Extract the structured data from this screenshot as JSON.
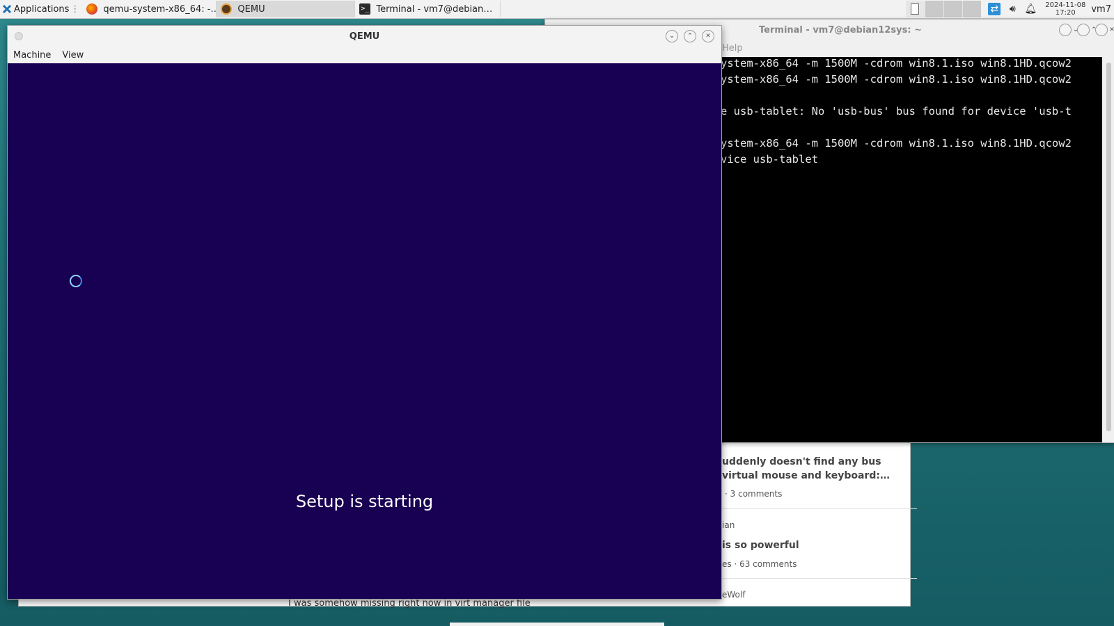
{
  "panel": {
    "applications_label": "Applications",
    "tasks": [
      {
        "label": "qemu-system-x86_64: -…",
        "icon": "firefox-icon"
      },
      {
        "label": "QEMU",
        "icon": "qemu-icon"
      },
      {
        "label": "Terminal - vm7@debian…",
        "icon": "terminal-icon"
      }
    ],
    "clock_date": "2024-11-08",
    "clock_time": "17:20",
    "user": "vm7"
  },
  "browser": {
    "card1_title_line1": "uddenly doesn't find any bus",
    "card1_title_line2": "virtual mouse and keyboard:…",
    "card1_comments": "3 comments",
    "card2_source": "ian",
    "card2_title": "is so powerful",
    "card2_meta_prefix": "es",
    "card2_comments": "63 comments",
    "card3_author": "eWolf",
    "bottom_text": "I was somehow missing right now in virt manager file"
  },
  "terminal": {
    "title": "Terminal - vm7@debian12sys: ~",
    "menu_help": "Help",
    "lines": [
      "ystem-x86_64 -m 1500M -cdrom win8.1.iso win8.1HD.qcow2",
      "ystem-x86_64 -m 1500M -cdrom win8.1.iso win8.1HD.qcow2",
      "",
      "e usb-tablet: No 'usb-bus' bus found for device 'usb-t",
      "",
      "ystem-x86_64 -m 1500M -cdrom win8.1.iso win8.1HD.qcow2",
      "vice usb-tablet"
    ]
  },
  "qemu": {
    "title": "QEMU",
    "menu": [
      "Machine",
      "View"
    ],
    "setup_text": "Setup is starting"
  }
}
